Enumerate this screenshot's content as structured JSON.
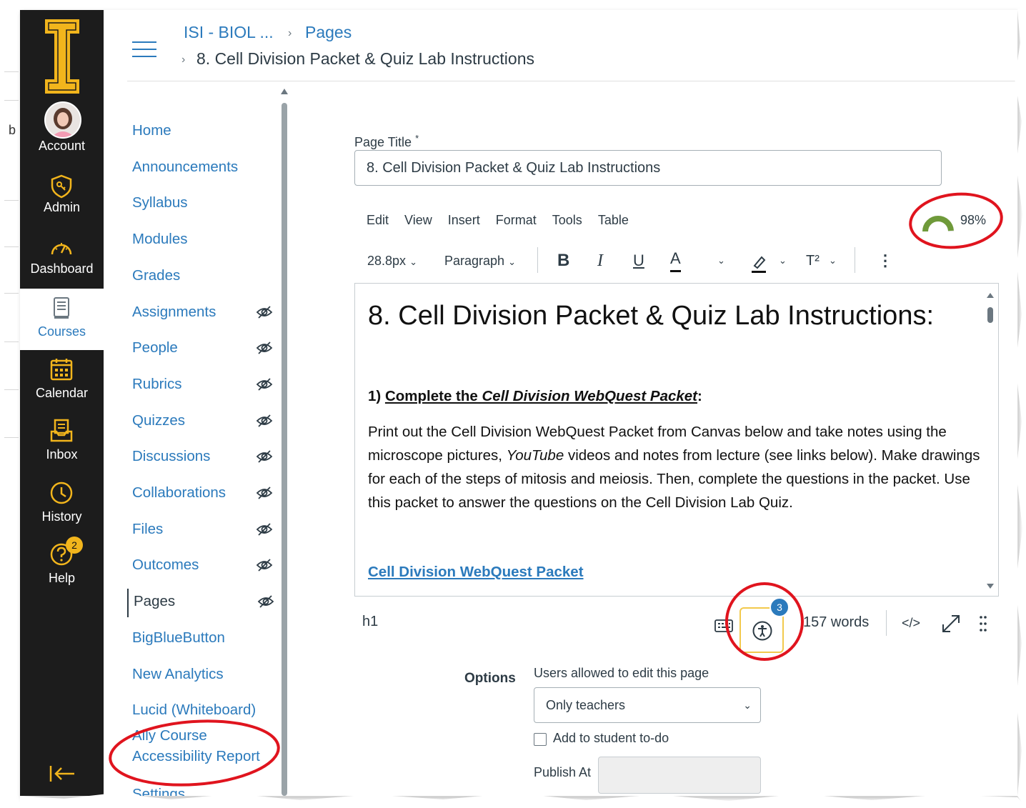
{
  "outer": {
    "left_letter": "b"
  },
  "global_nav": {
    "items": [
      {
        "label": "Account",
        "icon": "avatar"
      },
      {
        "label": "Admin",
        "icon": "shield-icon"
      },
      {
        "label": "Dashboard",
        "icon": "dashboard-icon"
      },
      {
        "label": "Courses",
        "icon": "courses-icon"
      },
      {
        "label": "Calendar",
        "icon": "calendar-icon"
      },
      {
        "label": "Inbox",
        "icon": "inbox-icon"
      },
      {
        "label": "History",
        "icon": "clock-icon"
      },
      {
        "label": "Help",
        "icon": "help-icon"
      }
    ],
    "help_badge": "2",
    "colors": {
      "bg": "#1c1c1c",
      "logo": "#f2b51c",
      "active_text": "#2b7abc"
    }
  },
  "breadcrumb": {
    "course": "ISI - BIOL ...",
    "section": "Pages",
    "page": "8. Cell Division Packet & Quiz Lab Instructions"
  },
  "course_nav": {
    "items": [
      {
        "label": "Home",
        "hidden": false
      },
      {
        "label": "Announcements",
        "hidden": false
      },
      {
        "label": "Syllabus",
        "hidden": false
      },
      {
        "label": "Modules",
        "hidden": false
      },
      {
        "label": "Grades",
        "hidden": false
      },
      {
        "label": "Assignments",
        "hidden": true
      },
      {
        "label": "People",
        "hidden": true
      },
      {
        "label": "Rubrics",
        "hidden": true
      },
      {
        "label": "Quizzes",
        "hidden": true
      },
      {
        "label": "Discussions",
        "hidden": true
      },
      {
        "label": "Collaborations",
        "hidden": true
      },
      {
        "label": "Files",
        "hidden": true
      },
      {
        "label": "Outcomes",
        "hidden": true
      },
      {
        "label": "Pages",
        "hidden": true,
        "active": true
      },
      {
        "label": "BigBlueButton",
        "hidden": false
      },
      {
        "label": "New Analytics",
        "hidden": false
      },
      {
        "label": "Lucid (Whiteboard)",
        "hidden": false
      }
    ],
    "ally_line1": "Ally Course",
    "ally_line2": "Accessibility Report",
    "settings": "Settings"
  },
  "editor": {
    "page_title_label": "Page Title",
    "required_mark": "*",
    "page_title_value": "8. Cell Division Packet & Quiz Lab Instructions",
    "menus": [
      "Edit",
      "View",
      "Insert",
      "Format",
      "Tools",
      "Table"
    ],
    "accessibility_score": "98%",
    "accessibility_score_value": 0.98,
    "font_size": "28.8px",
    "block_format": "Paragraph",
    "bold": "B",
    "italic": "I",
    "underline": "U",
    "text_color": "A",
    "superscript": "T²",
    "more": "⋮"
  },
  "content": {
    "heading": "8. Cell Division Packet & Quiz Lab Instructions:",
    "step_prefix": "1) ",
    "step_underlined_a": "Complete the ",
    "step_italic": "Cell Division WebQuest Packet",
    "step_suffix": ":",
    "para_a": "Print out the Cell Division WebQuest Packet from Canvas below and take notes using the microscope pictures, ",
    "para_italic": "YouTube",
    "para_b": " videos and notes from lecture (see links below). Make drawings for each of the steps of mitosis and meiosis. Then, complete the questions in the packet. Use this packet to answer the questions on the Cell Division Lab Quiz.",
    "link": "Cell Division WebQuest Packet"
  },
  "statusbar": {
    "element_path": "h1",
    "a11y_badge": "3",
    "word_count": "157 words",
    "html_toggle": "</>"
  },
  "options": {
    "label": "Options",
    "edit_label": "Users allowed to edit this page",
    "edit_value": "Only teachers",
    "todo_label": "Add to student to-do",
    "publish_label": "Publish At"
  },
  "annotation_color": "#e0141e"
}
